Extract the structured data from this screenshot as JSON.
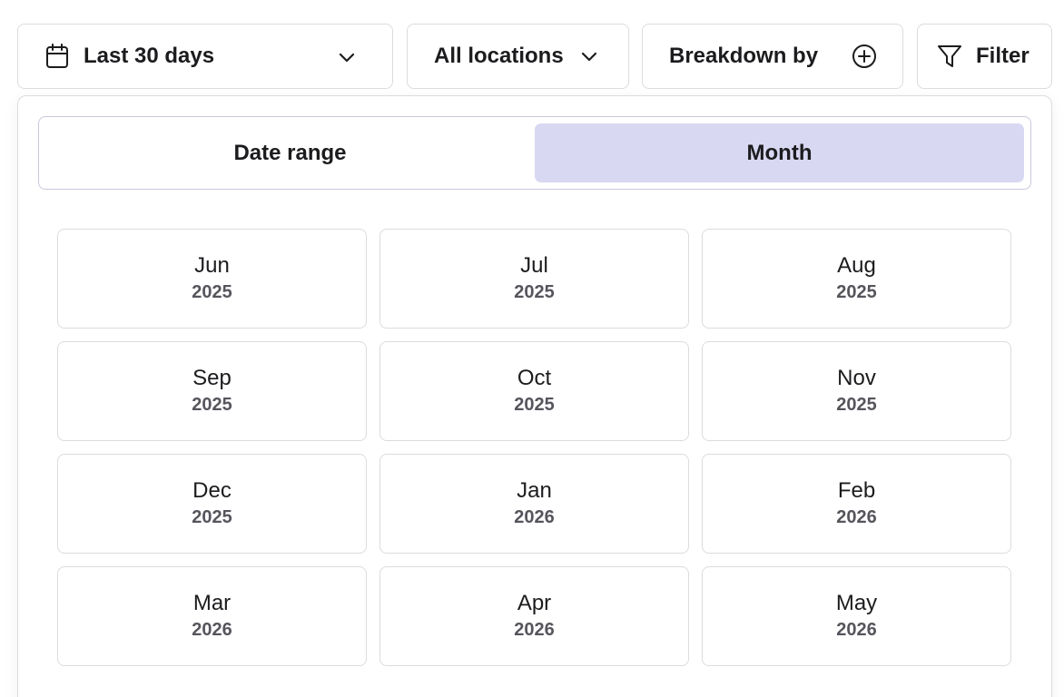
{
  "toolbar": {
    "date_label": "Last 30 days",
    "location_label": "All locations",
    "breakdown_label": "Breakdown by",
    "filter_label": "Filter"
  },
  "segmented": {
    "options": [
      "Date range",
      "Month"
    ],
    "selected": "Month"
  },
  "months": [
    {
      "month": "Jun",
      "year": "2025"
    },
    {
      "month": "Jul",
      "year": "2025"
    },
    {
      "month": "Aug",
      "year": "2025"
    },
    {
      "month": "Sep",
      "year": "2025"
    },
    {
      "month": "Oct",
      "year": "2025"
    },
    {
      "month": "Nov",
      "year": "2025"
    },
    {
      "month": "Dec",
      "year": "2025"
    },
    {
      "month": "Jan",
      "year": "2026"
    },
    {
      "month": "Feb",
      "year": "2026"
    },
    {
      "month": "Mar",
      "year": "2026"
    },
    {
      "month": "Apr",
      "year": "2026"
    },
    {
      "month": "May",
      "year": "2026"
    }
  ],
  "colors": {
    "selected_segment": "#d8d8f2",
    "border": "#dcdce0",
    "text": "#1c1c1f",
    "muted_text": "#55555c"
  },
  "icons": {
    "date": "calendar-icon",
    "location": "chevron-down-icon",
    "breakdown": "plus-circle-icon",
    "filter": "filter-icon"
  }
}
